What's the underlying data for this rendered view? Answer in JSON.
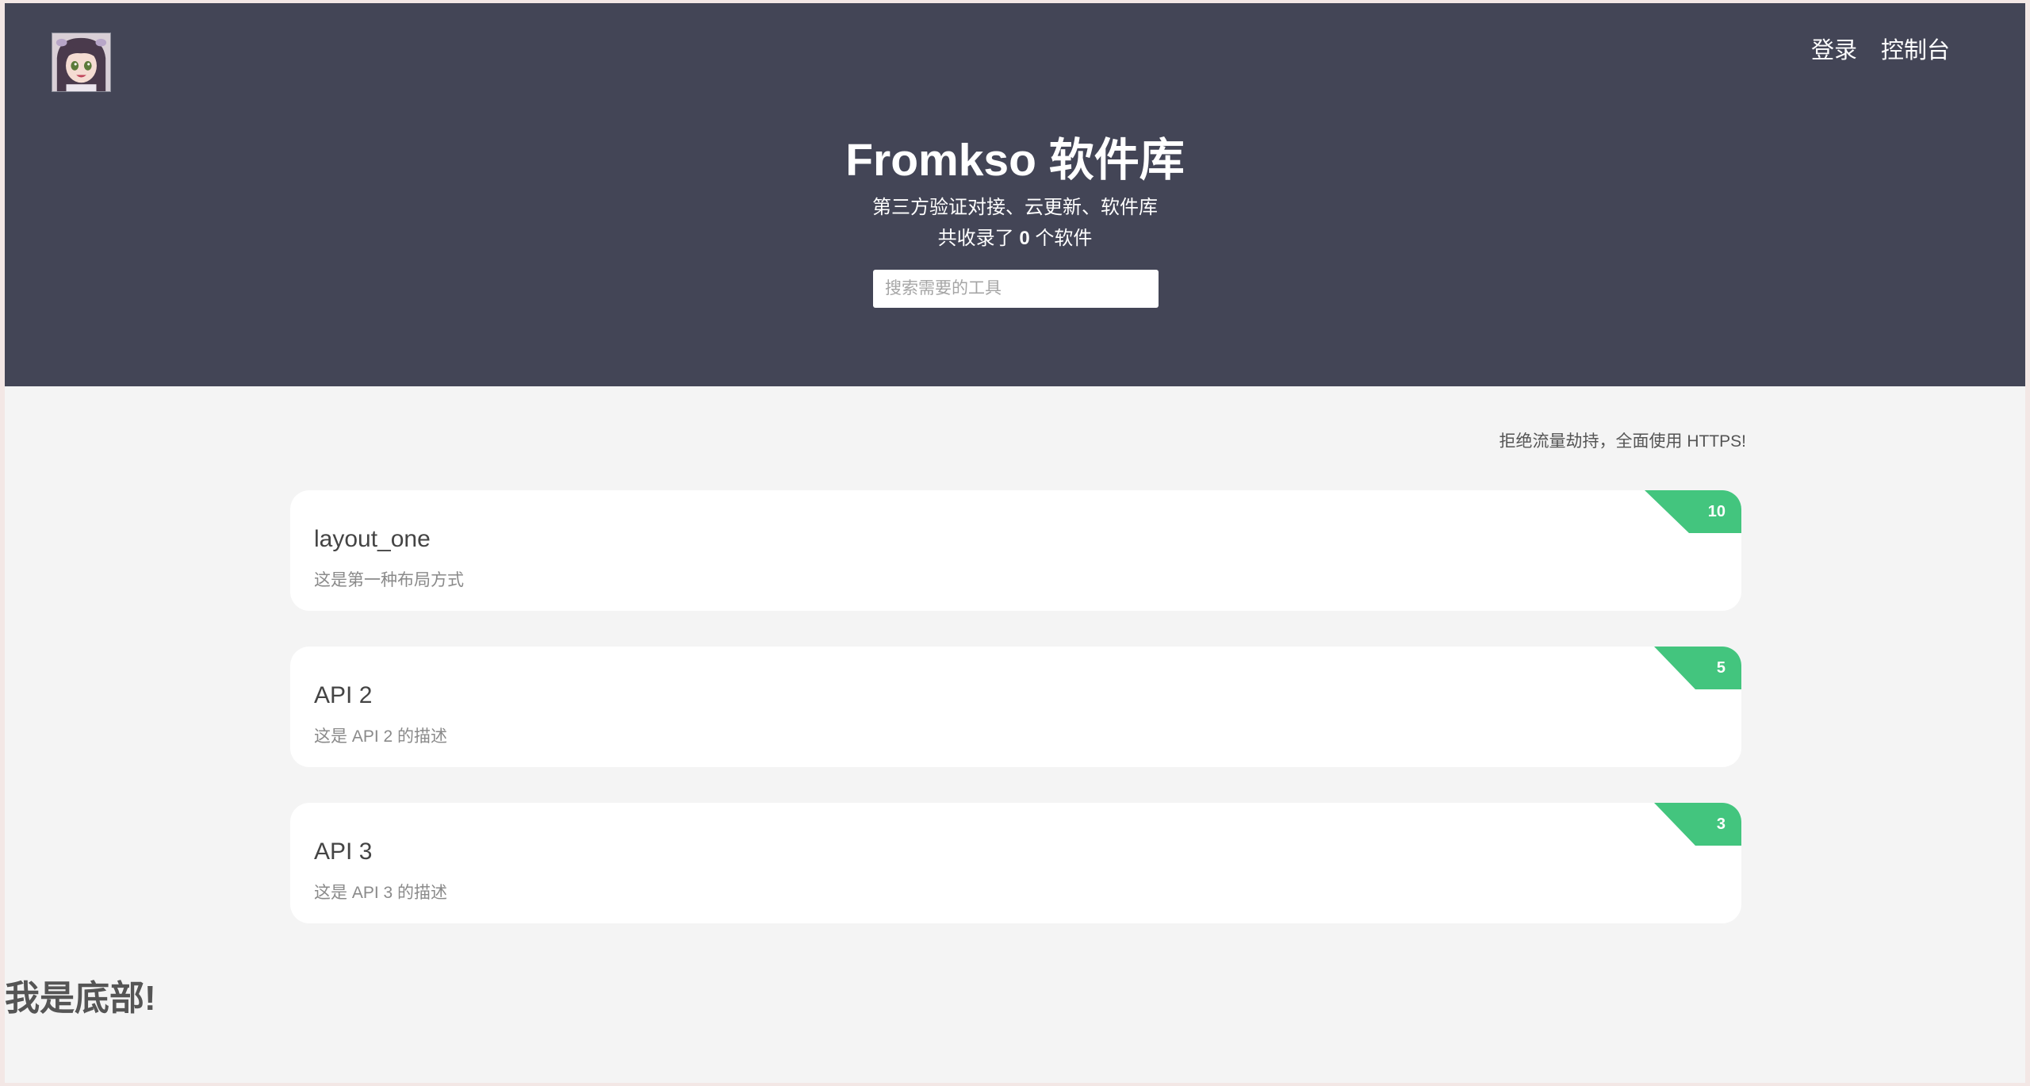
{
  "header": {
    "avatar_alt": "avatar",
    "nav": {
      "login": "登录",
      "console": "控制台"
    }
  },
  "hero": {
    "title": "Fromkso 软件库",
    "subtitle": "第三方验证对接、云更新、软件库",
    "count_prefix": "共收录了",
    "count_value": "0",
    "count_suffix": "个软件",
    "search_placeholder": "搜索需要的工具"
  },
  "notice": "拒绝流量劫持，全面使用 HTTPS!",
  "cards": [
    {
      "title": "layout_one",
      "description": "这是第一种布局方式",
      "badge": "10"
    },
    {
      "title": "API 2",
      "description": "这是 API 2 的描述",
      "badge": "5"
    },
    {
      "title": "API 3",
      "description": "这是 API 3 的描述",
      "badge": "3"
    }
  ],
  "footer": {
    "text": "我是底部!"
  },
  "colors": {
    "hero_background": "#434556",
    "page_background": "#f4f4f4",
    "badge": "#43c57e",
    "card": "#ffffff"
  }
}
